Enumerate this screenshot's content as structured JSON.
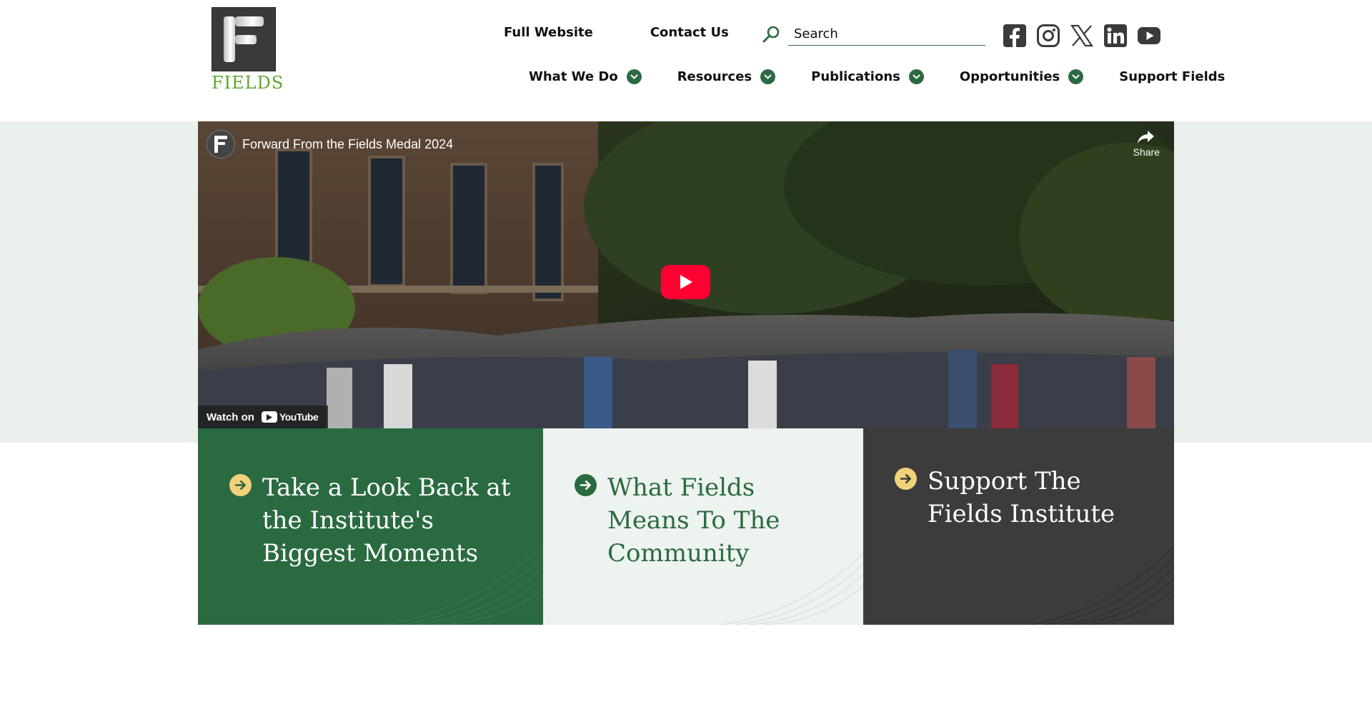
{
  "logo": {
    "text": "FIELDS"
  },
  "header": {
    "top_links": [
      "Full Website",
      "Contact Us"
    ],
    "search": {
      "placeholder": "Search"
    },
    "social": [
      "facebook-icon",
      "instagram-icon",
      "x-icon",
      "linkedin-icon",
      "youtube-icon"
    ]
  },
  "nav": {
    "items": [
      {
        "label": "What We Do",
        "has_dropdown": true
      },
      {
        "label": "Resources",
        "has_dropdown": true
      },
      {
        "label": "Publications",
        "has_dropdown": true
      },
      {
        "label": "Opportunities",
        "has_dropdown": true
      },
      {
        "label": "Support Fields",
        "has_dropdown": false
      }
    ]
  },
  "video": {
    "title": "Forward From the Fields Medal 2024",
    "share_label": "Share",
    "watch_on": "Watch on",
    "platform": "YouTube"
  },
  "cards": [
    {
      "text": "Take a Look Back at the Institute's Biggest Moments"
    },
    {
      "text": "What Fields Means To The Community"
    },
    {
      "text": "Support The Fields Institute"
    }
  ],
  "colors": {
    "brand_green": "#2a6a40",
    "logo_green": "#5ea82f",
    "accent_yellow": "#f2d27a",
    "band_bg": "#eaf1ec",
    "dark_card": "#3c3c3c",
    "youtube_red": "#ff0033"
  }
}
